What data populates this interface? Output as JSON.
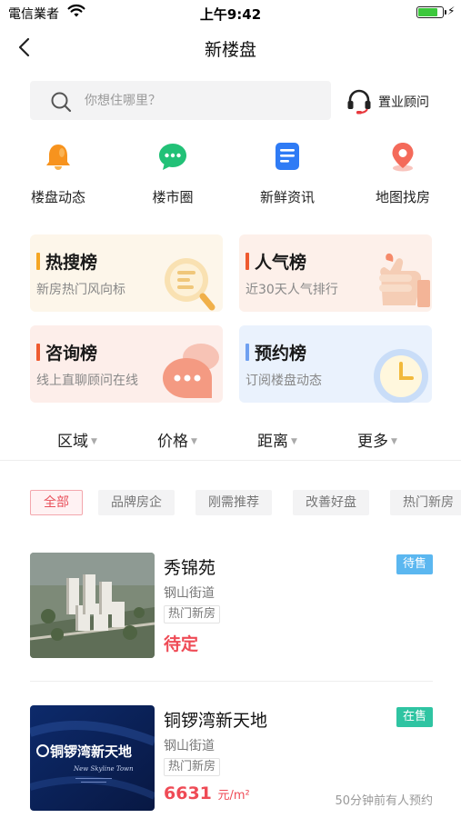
{
  "status_bar": {
    "carrier": "電信業者",
    "time": "上午9:42"
  },
  "nav": {
    "title": "新楼盘"
  },
  "search": {
    "placeholder": "你想住哪里？",
    "advisor_label": "置业顾问"
  },
  "quick_entries": [
    {
      "label": "楼盘动态",
      "icon": "bell-icon",
      "color": "#f7931e"
    },
    {
      "label": "楼市圈",
      "icon": "chat-bubble-icon",
      "color": "#22c177"
    },
    {
      "label": "新鲜资讯",
      "icon": "document-icon",
      "color": "#2f7bf5"
    },
    {
      "label": "地图找房",
      "icon": "map-pin-icon",
      "color": "#f46a5a"
    }
  ],
  "cards": [
    {
      "title": "热搜榜",
      "subtitle": "新房热门风向标",
      "accent": "#f5a623",
      "bg": "#fdf6ea",
      "art": "magnifier-icon"
    },
    {
      "title": "人气榜",
      "subtitle": "近30天人气排行",
      "accent": "#ef5a2f",
      "bg": "#fdf0ea",
      "art": "thumbs-up-icon"
    },
    {
      "title": "咨询榜",
      "subtitle": "线上直聊顾问在线",
      "accent": "#ef5a2f",
      "bg": "#fdeeea",
      "art": "chat-icon"
    },
    {
      "title": "预约榜",
      "subtitle": "订阅楼盘动态",
      "accent": "#6fa0f0",
      "bg": "#eaf2fd",
      "art": "clock-icon"
    }
  ],
  "filters": [
    "区域",
    "价格",
    "距离",
    "更多"
  ],
  "tags": [
    {
      "label": "全部",
      "active": true
    },
    {
      "label": "品牌房企",
      "active": false
    },
    {
      "label": "刚需推荐",
      "active": false
    },
    {
      "label": "改善好盘",
      "active": false
    },
    {
      "label": "热门新房",
      "active": false
    }
  ],
  "listings": [
    {
      "name": "秀锦苑",
      "address": "钢山街道",
      "tag": "热门新房",
      "price": "待定",
      "unit": "",
      "status": "待售",
      "status_color": "#5bb7f0",
      "note": ""
    },
    {
      "name": "铜锣湾新天地",
      "address": "钢山街道",
      "tag": "热门新房",
      "price": "6631",
      "unit": "元/m²",
      "status": "在售",
      "status_color": "#2fc4a2",
      "note": "50分钟前有人预约",
      "thumb_text": "铜锣湾新天地",
      "thumb_subtext": "New Skyline Town"
    }
  ]
}
